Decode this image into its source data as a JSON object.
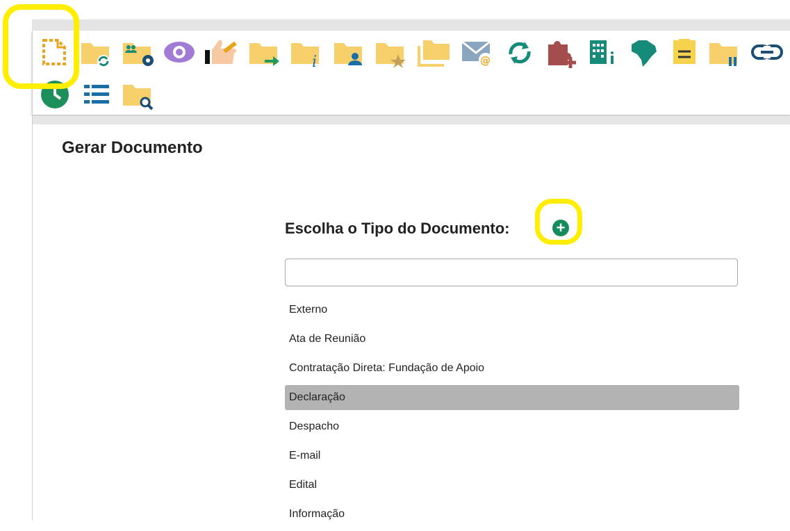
{
  "toolbar": {
    "icons": [
      "new-document-icon",
      "folder-sync-icon",
      "folder-users-settings-icon",
      "eye-icon",
      "thumbs-up-icon",
      "folder-send-icon",
      "folder-info-icon",
      "folder-user-icon",
      "folder-star-icon",
      "folders-icon",
      "email-icon",
      "refresh-icon",
      "puzzle-add-icon",
      "building-icon",
      "brazil-map-icon",
      "note-icon",
      "folder-pause-icon",
      "link-icon",
      "clock-icon",
      "list-icon",
      "folder-search-icon"
    ],
    "colors": {
      "folder": "#f7cf6b",
      "teal": "#168b7a",
      "green": "#1d9a5d",
      "purple": "#a27bd6",
      "red": "#a54c4c",
      "blue": "#1a6fa8"
    }
  },
  "page": {
    "title": "Gerar Documento",
    "choose_label": "Escolha o Tipo do Documento:",
    "add_symbol": "+",
    "search": {
      "value": "",
      "placeholder": ""
    }
  },
  "documents": [
    {
      "label": "Externo",
      "selected": false
    },
    {
      "label": "Ata de Reunião",
      "selected": false
    },
    {
      "label": "Contratação Direta: Fundação de Apoio",
      "selected": false
    },
    {
      "label": "Declaração",
      "selected": true
    },
    {
      "label": "Despacho",
      "selected": false
    },
    {
      "label": "E-mail",
      "selected": false
    },
    {
      "label": "Edital",
      "selected": false
    },
    {
      "label": "Informação",
      "selected": false
    }
  ],
  "annotations": {
    "highlight_color": "#ffee00"
  }
}
